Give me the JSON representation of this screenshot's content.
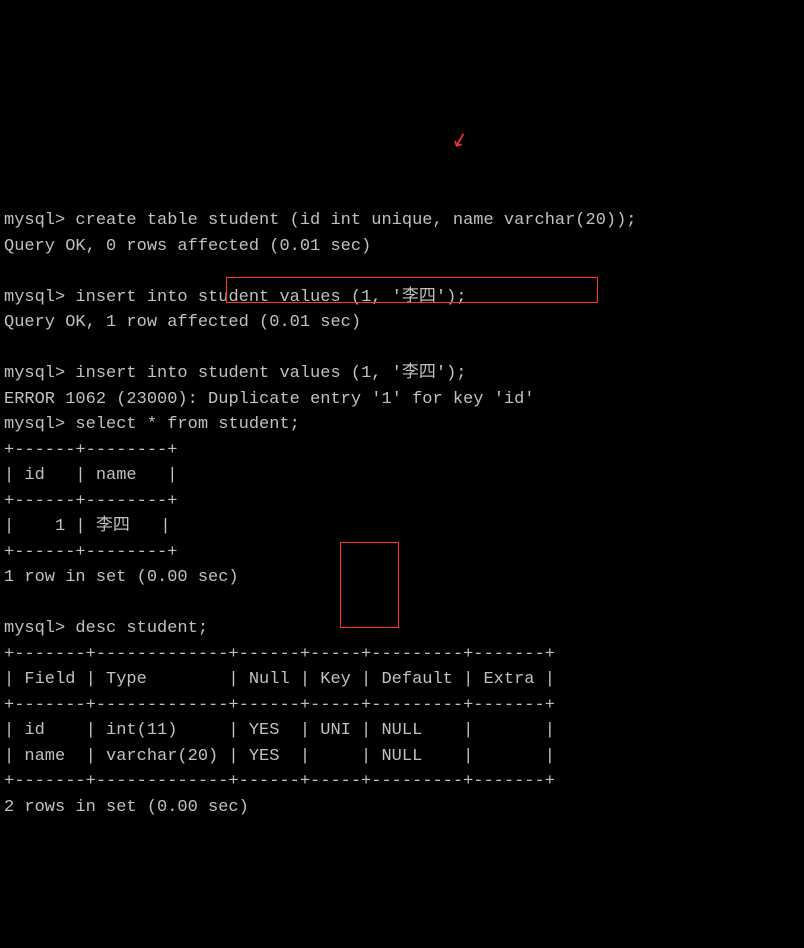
{
  "prompt": "mysql>",
  "cmd1": " create table student (id int unique, name varchar(20));",
  "result1": "Query OK, 0 rows affected (0.01 sec)",
  "cmd2": " insert into student values (1, '李四');",
  "result2": "Query OK, 1 row affected (0.01 sec)",
  "cmd3": " insert into student values (1, '李四');",
  "error3_prefix": "ERROR 1062 (23000): ",
  "error3_boxed": "Duplicate entry '1' for key 'id'",
  "cmd4": " select * from student;",
  "table1": {
    "border_top": "+------+--------+",
    "header": "| id   | name   |",
    "border_mid": "+------+--------+",
    "row1": "|    1 | 李四   |",
    "border_bot": "+------+--------+"
  },
  "result4": "1 row in set (0.00 sec)",
  "cmd5": " desc student;",
  "table2": {
    "border_top": "+-------+-------------+------+-----+---------+-------+",
    "header": "| Field | Type        | Null | Key | Default | Extra |",
    "border_mid": "+-------+-------------+------+-----+---------+-------+",
    "row1": "| id    | int(11)     | YES  | UNI | NULL    |       |",
    "row2": "| name  | varchar(20) | YES  |     | NULL    |       |",
    "border_bot": "+-------+-------------+------+-----+---------+-------+"
  },
  "result5": "2 rows in set (0.00 sec)"
}
